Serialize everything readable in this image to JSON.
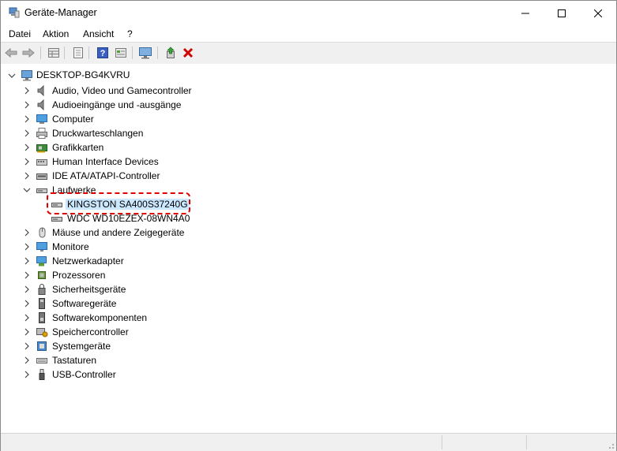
{
  "window": {
    "title": "Geräte-Manager"
  },
  "colors": {
    "accent": "#0078d7",
    "highlight": "#e00000",
    "delete": "#d00000"
  },
  "menu": {
    "items": [
      "Datei",
      "Aktion",
      "Ansicht",
      "?"
    ]
  },
  "toolbar": {
    "buttons": [
      "back-icon",
      "forward-icon",
      "properties-grid-icon",
      "document-icon",
      "help-icon",
      "details-icon",
      "monitor-icon",
      "update-driver-icon",
      "uninstall-icon"
    ]
  },
  "tree": {
    "root": "DESKTOP-BG4KVRU",
    "categories": [
      "Audio, Video und Gamecontroller",
      "Audioeingänge und -ausgänge",
      "Computer",
      "Druckwarteschlangen",
      "Grafikkarten",
      "Human Interface Devices",
      "IDE ATA/ATAPI-Controller",
      "Laufwerke",
      "Mäuse und andere Zeigegeräte",
      "Monitore",
      "Netzwerkadapter",
      "Prozessoren",
      "Sicherheitsgeräte",
      "Softwaregeräte",
      "Softwarekomponenten",
      "Speichercontroller",
      "Systemgeräte",
      "Tastaturen",
      "USB-Controller"
    ],
    "drives": [
      "KINGSTON SA400S37240G",
      "WDC WD10EZEX-08WN4A0"
    ]
  }
}
